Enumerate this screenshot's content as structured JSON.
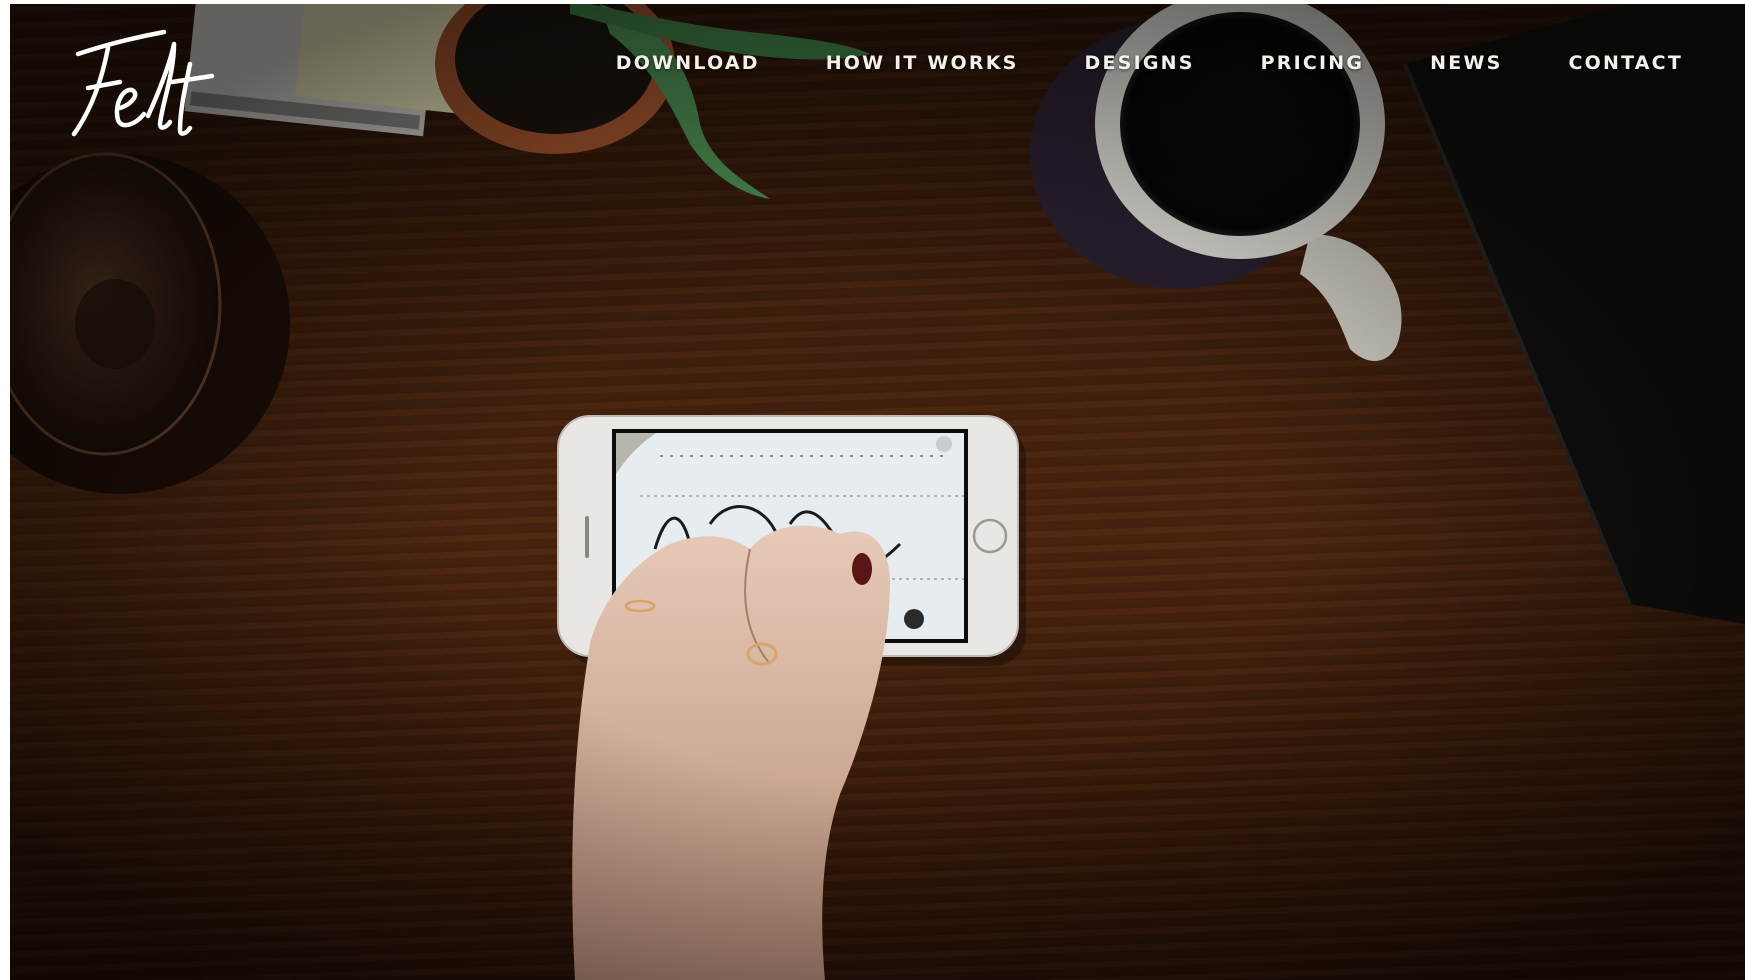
{
  "brand": {
    "logo_text": "Felt"
  },
  "nav": {
    "items": [
      {
        "label": "DOWNLOAD"
      },
      {
        "label": "HOW IT WORKS"
      },
      {
        "label": "DESIGNS"
      },
      {
        "label": "PRICING"
      },
      {
        "label": "NEWS"
      },
      {
        "label": "CONTACT"
      }
    ]
  },
  "colors": {
    "nav_text": "#f4f0ea",
    "wood": "#4b250f",
    "phone_body": "#e9e7e4",
    "screen": "#e6ecef"
  }
}
